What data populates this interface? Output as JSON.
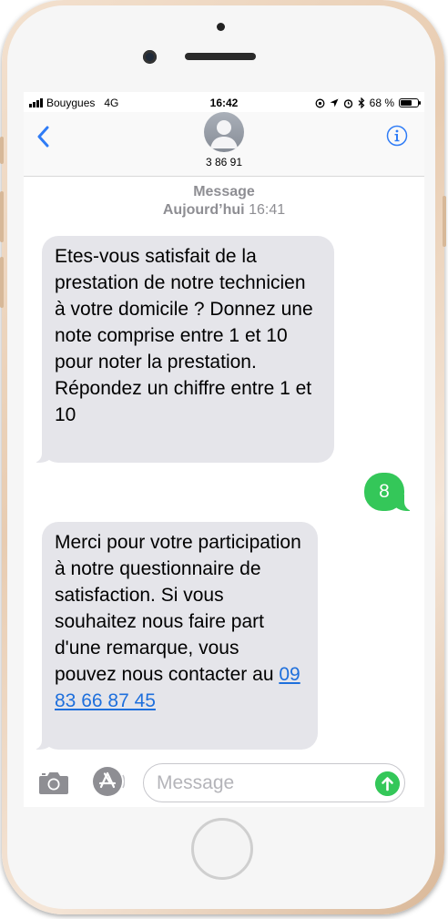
{
  "status_bar": {
    "carrier": "Bouygues",
    "network": "4G",
    "time": "16:42",
    "battery": "68 %",
    "battery_level": 0.68
  },
  "header": {
    "back_icon": "chevron-left-icon",
    "contact": "3 86 91",
    "info_icon": "info-icon"
  },
  "thread": {
    "service_label": "Message",
    "day_label": "Aujourd’hui",
    "time_label": "16:41"
  },
  "messages": [
    {
      "direction": "incoming",
      "text": "Etes-vous satisfait de la prestation de notre technicien à votre domicile ? Donnez une note comprise entre 1 et 10 pour noter la prestation. Répondez un chiffre entre 1 et 10"
    },
    {
      "direction": "outgoing",
      "text": "8"
    },
    {
      "direction": "incoming",
      "text": "Merci pour votre participation à notre questionnaire de satisfaction. Si vous souhaitez nous faire part d'une remarque, vous pouvez nous contacter au",
      "link": "09 83 66 87 45"
    }
  ],
  "composer": {
    "placeholder": "Message",
    "camera_icon": "camera-icon",
    "apps_icon": "app-store-icon",
    "send_icon": "send-arrow-icon"
  },
  "colors": {
    "incoming_bubble": "#e5e5ea",
    "outgoing_bubble": "#34c759",
    "link": "#1e6fdc",
    "accent": "#2f7cf6"
  }
}
